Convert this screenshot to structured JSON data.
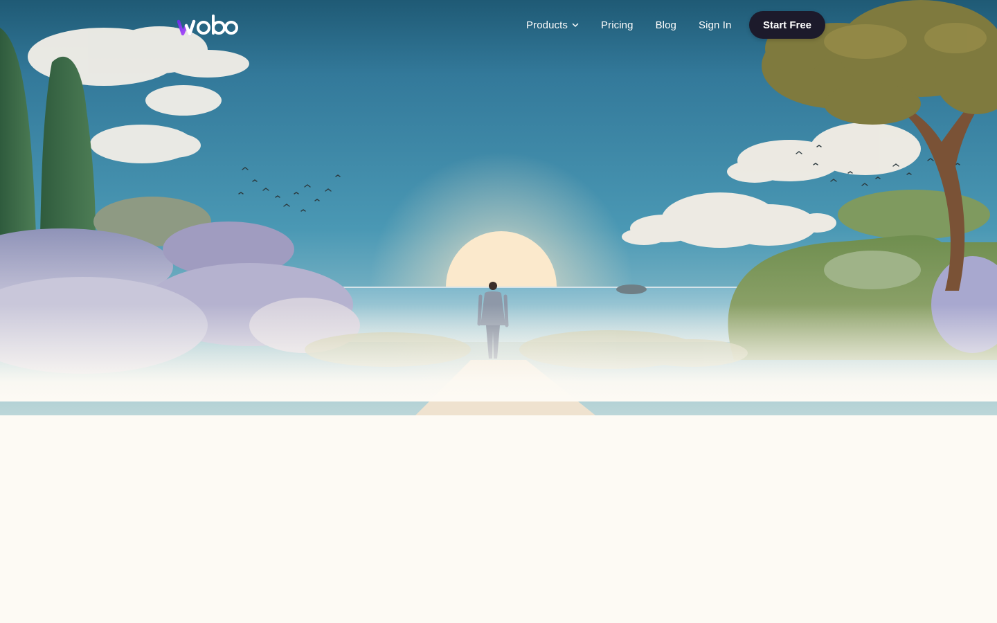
{
  "brand": {
    "name": "wobo",
    "colors": {
      "accent_purple": "#7b3cf0",
      "accent_pink": "#c45cff",
      "button_dark": "#1c1a2b",
      "page_background": "#fdfaf4",
      "sky": "#3f8fb0"
    }
  },
  "nav": {
    "products_label": "Products",
    "products_icon": "chevron-down-icon",
    "pricing_label": "Pricing",
    "blog_label": "Blog",
    "sign_in_label": "Sign In",
    "cta_label": "Start Free"
  },
  "hero": {
    "image_alt": "hero-illustration"
  }
}
